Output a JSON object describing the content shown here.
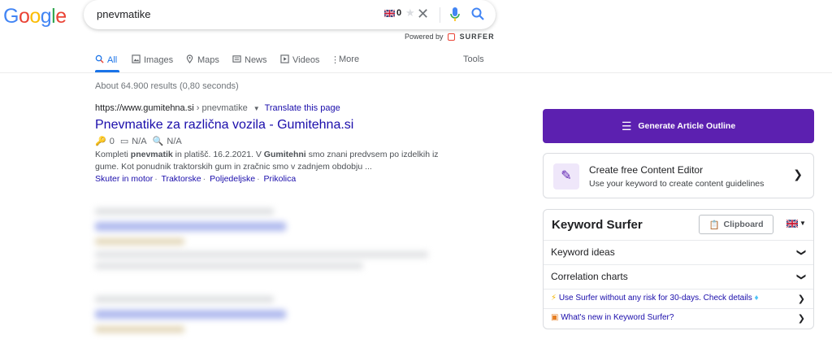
{
  "logo": "Google",
  "search": {
    "query": "pnevmatike",
    "badge_count": "0",
    "powered_by": "Powered by",
    "powered_brand": "SURFER"
  },
  "tabs": [
    {
      "label": "All",
      "icon": "search-icon",
      "active": true
    },
    {
      "label": "Images",
      "icon": "image-icon"
    },
    {
      "label": "Maps",
      "icon": "map-pin-icon"
    },
    {
      "label": "News",
      "icon": "news-icon"
    },
    {
      "label": "Videos",
      "icon": "play-icon"
    },
    {
      "label": "More",
      "icon": "more-dots-icon"
    }
  ],
  "tools_label": "Tools",
  "result_stats": "About 64.900 results (0,80 seconds)",
  "result": {
    "url": "https://www.gumitehna.si",
    "breadcrumb": "› pnevmatike",
    "translate": "Translate this page",
    "title": "Pnevmatike za različna vozila - Gumitehna.si",
    "metric_keywords": "0",
    "metric_traffic": "N/A",
    "metric_words": "N/A",
    "snippet_parts": [
      "Kompleti ",
      "pnevmatik",
      " in platišč. 16.2.2021. V ",
      "Gumitehni",
      " smo znani predvsem po izdelkih iz gume. Kot ponudnik traktorskih gum in zračnic smo v zadnjem obdobju ..."
    ],
    "sitelinks": [
      "Skuter in motor",
      "Traktorske",
      "Poljedeljske",
      "Prikolica"
    ]
  },
  "sidebar": {
    "generate_button": "Generate Article Outline",
    "editor_title": "Create free Content Editor",
    "editor_subtitle": "Use your keyword to create content guidelines",
    "ks_title": "Keyword Surfer",
    "clipboard_label": "Clipboard",
    "rows": [
      "Keyword ideas",
      "Correlation charts"
    ],
    "promo1": "Use Surfer without any risk for 30-days. Check details",
    "promo2": "What's new in Keyword Surfer?"
  },
  "colors": {
    "link": "#1a0dab",
    "accent": "#1a73e8",
    "surfer_purple": "#5c20b0"
  }
}
